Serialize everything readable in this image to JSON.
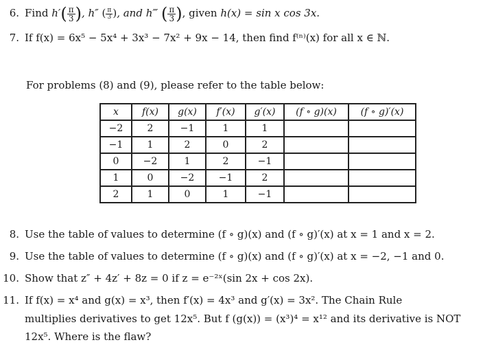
{
  "problems": {
    "p6": {
      "number": "6.",
      "text_find": "Find",
      "h1": "h′",
      "h2": ", h″",
      "h3": ", and h‴",
      "pi": "π",
      "three": "3",
      "given": ", given",
      "hx": "h(x) = sin x cos 3x."
    },
    "p7": {
      "number": "7.",
      "text": "If f(x) = 6x⁵ − 5x⁴ + 3x³ − 7x² + 9x − 14, then find f⁽ⁿ⁾(x) for all x ∈ ℕ."
    },
    "intro": "For problems (8) and (9), please refer to the table below:",
    "p8": {
      "number": "8.",
      "text": "Use the table of values to determine (f ∘ g)(x) and (f ∘ g)′(x) at x = 1 and x = 2."
    },
    "p9": {
      "number": "9.",
      "text": "Use the table of values to determine (f ∘ g)(x) and (f ∘ g)′(x) at x = −2, −1 and 0."
    },
    "p10": {
      "number": "10.",
      "text": "Show that z″ + 4z′ + 8z = 0 if z = e⁻²ˣ(sin 2x + cos 2x)."
    },
    "p11": {
      "number": "11.",
      "line1": "If f(x) = x⁴ and g(x) = x³, then f′(x) = 4x³ and g′(x) = 3x². The Chain Rule",
      "line2": "multiplies derivatives to get 12x⁵. But f (g(x)) = (x³)⁴ = x¹² and its derivative is NOT",
      "line3": "12x⁵. Where is the flaw?"
    }
  },
  "table": {
    "headers": [
      "x",
      "f(x)",
      "g(x)",
      "f′(x)",
      "g′(x)",
      "(f ∘ g)(x)",
      "(f ∘ g)′(x)"
    ],
    "rows": [
      [
        "−2",
        "2",
        "−1",
        "1",
        "1",
        "",
        ""
      ],
      [
        "−1",
        "1",
        "2",
        "0",
        "2",
        "",
        ""
      ],
      [
        "0",
        "−2",
        "1",
        "2",
        "−1",
        "",
        ""
      ],
      [
        "1",
        "0",
        "−2",
        "−1",
        "2",
        "",
        ""
      ],
      [
        "2",
        "1",
        "0",
        "1",
        "−1",
        "",
        ""
      ]
    ]
  }
}
